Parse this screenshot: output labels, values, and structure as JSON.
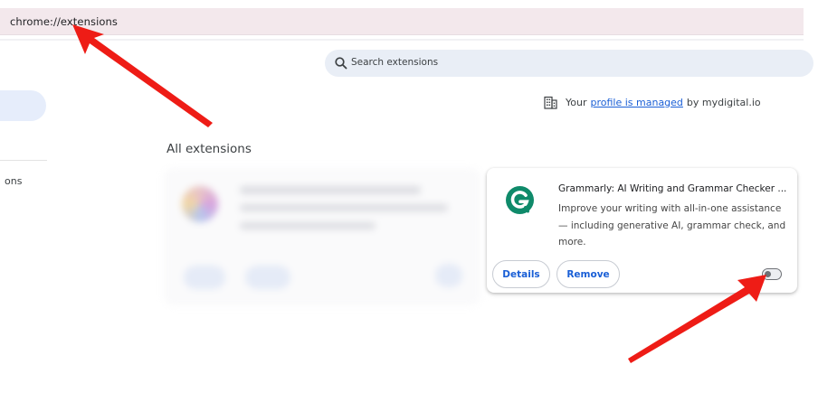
{
  "browser": {
    "url": "chrome://extensions"
  },
  "search": {
    "placeholder": "Search extensions",
    "icon": "search-icon"
  },
  "sidebar": {
    "item_partial_label": "ons"
  },
  "managed_notice": {
    "prefix": "Your",
    "link_text": "profile is managed",
    "suffix": "by mydigital.io",
    "icon": "building-icon"
  },
  "section": {
    "title": "All extensions"
  },
  "extension": {
    "name": "Grammarly: AI Writing and Grammar Checker ...",
    "description": "Improve your writing with all-in-one assistance— including generative AI, grammar check, and more.",
    "details_label": "Details",
    "remove_label": "Remove",
    "enabled": false,
    "logo_color": "#0f8a6a",
    "icon": "grammarly-logo-icon"
  },
  "colors": {
    "accent": "#1a5fd6",
    "annotation_arrow": "#ee1c16"
  }
}
